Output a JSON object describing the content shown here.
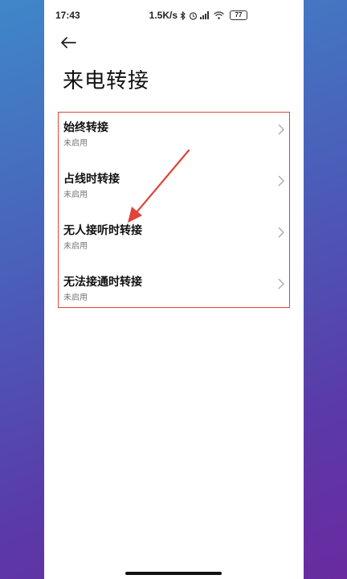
{
  "status_bar": {
    "time": "17:43",
    "network_speed": "1.5K/s",
    "icons": [
      "bluetooth-icon",
      "alarm-icon",
      "signal-icon",
      "wifi-icon"
    ],
    "battery": "77"
  },
  "header": {
    "back_icon": "back-arrow-icon",
    "title": "来电转接"
  },
  "list": {
    "items": [
      {
        "title": "始终转接",
        "subtitle": "未启用"
      },
      {
        "title": "占线时转接",
        "subtitle": "未启用"
      },
      {
        "title": "无人接听时转接",
        "subtitle": "未启用"
      },
      {
        "title": "无法接通时转接",
        "subtitle": "未启用"
      }
    ]
  },
  "colors": {
    "highlight": "#e0443a",
    "background_gradient": [
      "#3f87c9",
      "#6a2aa0"
    ]
  }
}
